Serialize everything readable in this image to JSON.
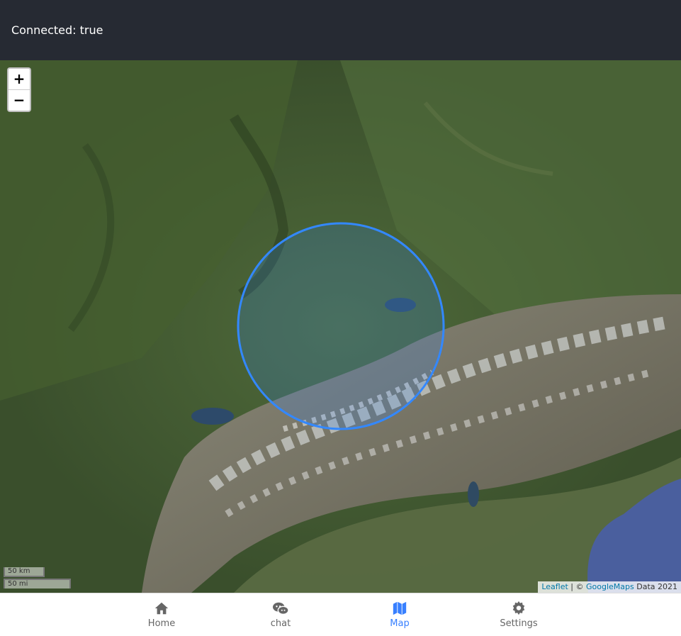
{
  "header": {
    "status_text": "Connected: true"
  },
  "map": {
    "zoom_in_label": "+",
    "zoom_out_label": "−",
    "scale_metric": "50 km",
    "scale_imperial": "50 mi",
    "attribution": {
      "leaflet": "Leaflet",
      "separator": " | © ",
      "provider": "GoogleMaps",
      "suffix": " Data 2021"
    },
    "circle_color": "#3388ff"
  },
  "tabs": [
    {
      "label": "Home",
      "icon": "home-icon"
    },
    {
      "label": "chat",
      "icon": "chat-icon"
    },
    {
      "label": "Map",
      "icon": "map-icon",
      "active": true
    },
    {
      "label": "Settings",
      "icon": "settings-icon"
    }
  ],
  "colors": {
    "header_bg": "#262a33",
    "accent": "#3880ff",
    "tab_inactive": "#666666"
  }
}
